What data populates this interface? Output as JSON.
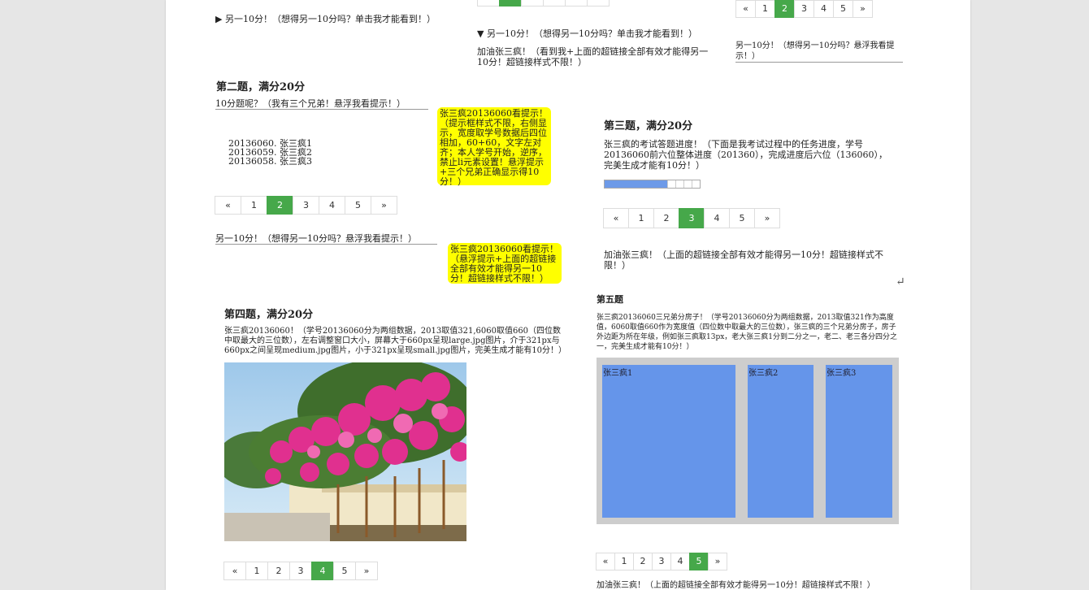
{
  "top_pager_partial": {
    "pages": [
      "",
      "",
      "",
      "",
      "",
      ""
    ],
    "active": 1
  },
  "details_closed": "▶ 另一10分！（想得另一10分吗？单击我才能看到！）",
  "details_open": "▼ 另一10分！（想得另一10分吗？单击我才能看到！）",
  "details_open_body": "加油张三疯！（看到我+上面的超链接全部有效才能得另一10分！超链接样式不限！）",
  "top_right_pager": {
    "pages": [
      "«",
      "1",
      "2",
      "3",
      "4",
      "5",
      "»"
    ],
    "active": 2
  },
  "top_right_link": "另一10分！（想得另一10分吗？悬浮我看提示！）",
  "q2": {
    "title": "第二题，满分20分",
    "hover_link": "10分题呢？（我有三个兄弟！悬浮我看提示！）",
    "list": [
      "20136060. 张三疯1",
      "20136059. 张三疯2",
      "20136058. 张三疯3"
    ],
    "tooltip": "张三疯20136060看提示！（提示框样式不限，右侧显示，宽度取学号数据后四位相加，60+60，文字左对齐；本人学号开始，逆序，禁止li元素设置！悬浮提示+三个兄弟正确显示得10分！）",
    "pager": {
      "pages": [
        "«",
        "1",
        "2",
        "3",
        "4",
        "5",
        "»"
      ],
      "active": 2
    },
    "extra_link": "另一10分！（想得另一10分吗？悬浮我看提示！）",
    "extra_tooltip": "张三疯20136060看提示！（悬浮提示+上面的超链接全部有效才能得另一10分！超链接样式不限！）"
  },
  "q3": {
    "title": "第三题，满分20分",
    "desc": "张三疯的考试答题进度！（下面是我考试过程中的任务进度，学号20136060前六位整体进度（201360），完成进度后六位（136060），完美生成才能有10分！）",
    "progress_ratio": 0.67,
    "pager": {
      "pages": [
        "«",
        "1",
        "2",
        "3",
        "4",
        "5",
        "»"
      ],
      "active": 3
    },
    "footer": "加油张三疯！（上面的超链接全部有效才能得另一10分！超链接样式不限！）",
    "enter_symbol": "↵"
  },
  "q4": {
    "title": "第四题，满分20分",
    "desc": "张三疯20136060！（学号20136060分为两组数据，2013取值321,6060取值660（四位数中取最大的三位数），左右调整窗口大小，屏幕大于660px呈现large.jpg图片，介于321px与660px之间呈现medium.jpg图片，小于321px呈现small.jpg图片，完美生成才能有10分！）",
    "pager": {
      "pages": [
        "«",
        "1",
        "2",
        "3",
        "4",
        "5",
        "»"
      ],
      "active": 4
    }
  },
  "q5": {
    "title": "第五题",
    "desc": "张三疯20136060三兄弟分房子！（学号20136060分为两组数据，2013取值321作为高度值，6060取值660作为宽度值（四位数中取最大的三位数），张三疯的三个兄弟分房子，房子外边距为所在年级，例如张三疯取13px，老大张三疯1分到二分之一，老二、老三各分四分之一，完美生成才能有10分！）",
    "rooms": [
      "张三疯1",
      "张三疯2",
      "张三疯3"
    ],
    "pager": {
      "pages": [
        "«",
        "1",
        "2",
        "3",
        "4",
        "5",
        "»"
      ],
      "active": 5
    },
    "footer": "加油张三疯！（上面的超链接全部有效才能得另一10分！超链接样式不限！）"
  },
  "colors": {
    "pager_active": "#46a84a",
    "tooltip": "#ffff00",
    "room": "#6595ea",
    "progress": "#6d9ae8"
  }
}
